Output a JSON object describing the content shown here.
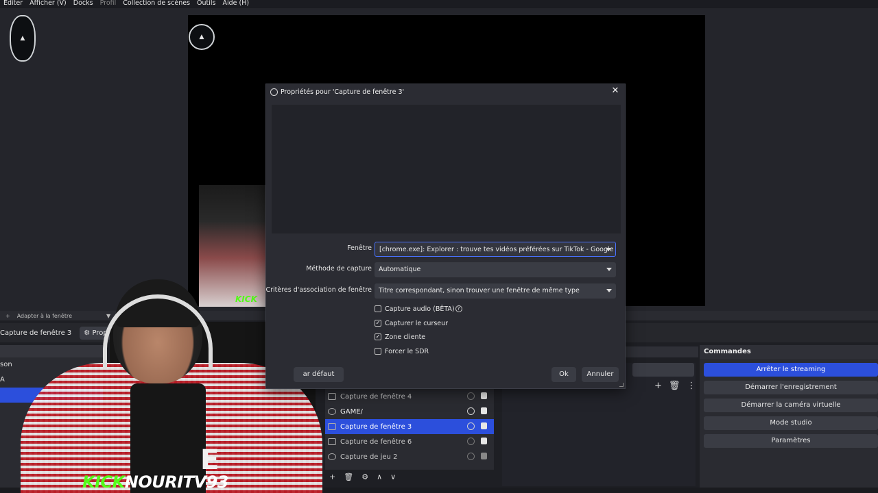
{
  "menu": {
    "items": [
      "Editer",
      "Afficher (V)",
      "Docks",
      "Profil",
      "Collection de scènes",
      "Outils",
      "Aide (H)"
    ]
  },
  "scene_bar": {
    "fit_label": "Adapter à la fenêtre"
  },
  "toolbar": {
    "source_name": "Capture de fenêtre 3",
    "properties_label": "Prop"
  },
  "scenes": {
    "items": [
      "son",
      "A",
      ""
    ]
  },
  "sources": {
    "items": [
      {
        "name": "Capture de fenêtre 4",
        "visible": false
      },
      {
        "name": "GAME/",
        "visible": true
      },
      {
        "name": "Capture de fenêtre 3",
        "visible": true
      },
      {
        "name": "Capture de fenêtre 6",
        "visible": false
      },
      {
        "name": "Capture de jeu 2",
        "visible": false
      }
    ]
  },
  "commands": {
    "title": "Commandes",
    "buttons": [
      "Arrêter le streaming",
      "Démarrer l'enregistrement",
      "Démarrer la caméra virtuelle",
      "Mode studio",
      "Paramètres"
    ]
  },
  "overlay": {
    "kick": "KICK",
    "username": "NOURITV93",
    "letter": "E"
  },
  "dialog": {
    "title": "Propriétés pour 'Capture de fenêtre 3'",
    "window_label": "Fenêtre",
    "window_value": "[chrome.exe]: Explorer : trouve tes vidéos préférées sur TikTok - Google Chrome",
    "method_label": "Méthode de capture",
    "method_value": "Automatique",
    "criteria_label": "Critères d'association de fenêtre",
    "criteria_value": "Titre correspondant, sinon trouver une fenêtre de même type",
    "checkboxes": [
      {
        "label": "Capture audio (BÊTA)",
        "checked": false
      },
      {
        "label": "Capturer le curseur",
        "checked": true
      },
      {
        "label": "Zone cliente",
        "checked": true
      },
      {
        "label": "Forcer le SDR",
        "checked": false
      }
    ],
    "defaults_label": "ar défaut",
    "ok_label": "Ok",
    "cancel_label": "Annuler"
  },
  "colors": {
    "accent": "#2c4fdc",
    "kick_green": "#53fc18"
  }
}
